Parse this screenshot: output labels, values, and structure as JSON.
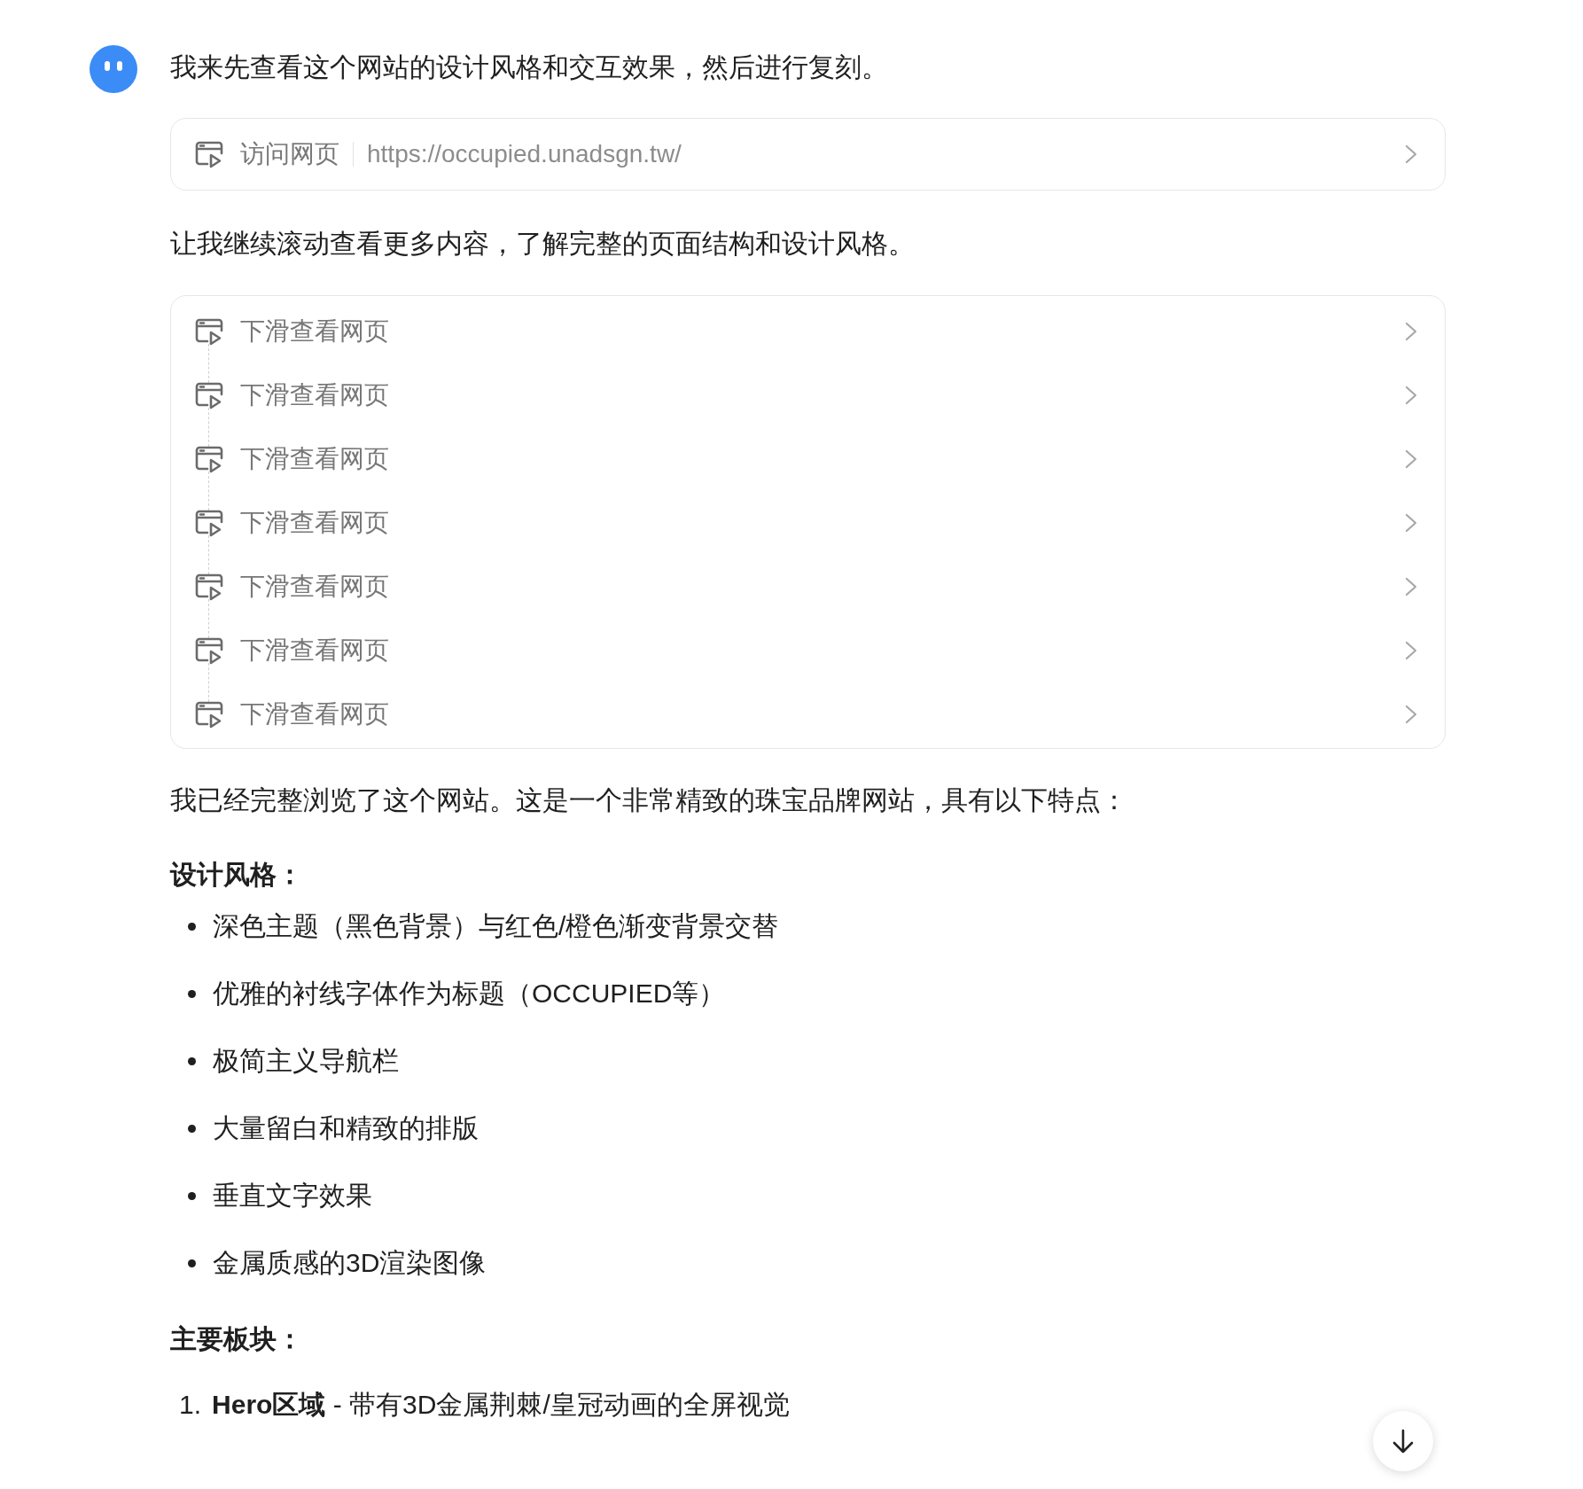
{
  "message": {
    "intro": "我来先查看这个网站的设计风格和交互效果，然后进行复刻。",
    "visit_step": {
      "label": "访问网页",
      "url": "https://occupied.unadsgn.tw/"
    },
    "follow_up": "让我继续滚动查看更多内容，了解完整的页面结构和设计风格。",
    "scroll_steps": [
      {
        "label": "下滑查看网页"
      },
      {
        "label": "下滑查看网页"
      },
      {
        "label": "下滑查看网页"
      },
      {
        "label": "下滑查看网页"
      },
      {
        "label": "下滑查看网页"
      },
      {
        "label": "下滑查看网页"
      },
      {
        "label": "下滑查看网页"
      }
    ],
    "summary": "我已经完整浏览了这个网站。这是一个非常精致的珠宝品牌网站，具有以下特点：",
    "design_heading": "设计风格：",
    "design_points": [
      "深色主题（黑色背景）与红色/橙色渐变背景交替",
      "优雅的衬线字体作为标题（OCCUPIED等）",
      "极简主义导航栏",
      "大量留白和精致的排版",
      "垂直文字效果",
      "金属质感的3D渲染图像"
    ],
    "sections_heading": "主要板块：",
    "sections": [
      {
        "number": "1.",
        "text": "**Hero区域** - 带有3D金属荆棘/皇冠动画的全屏视觉"
      }
    ]
  }
}
